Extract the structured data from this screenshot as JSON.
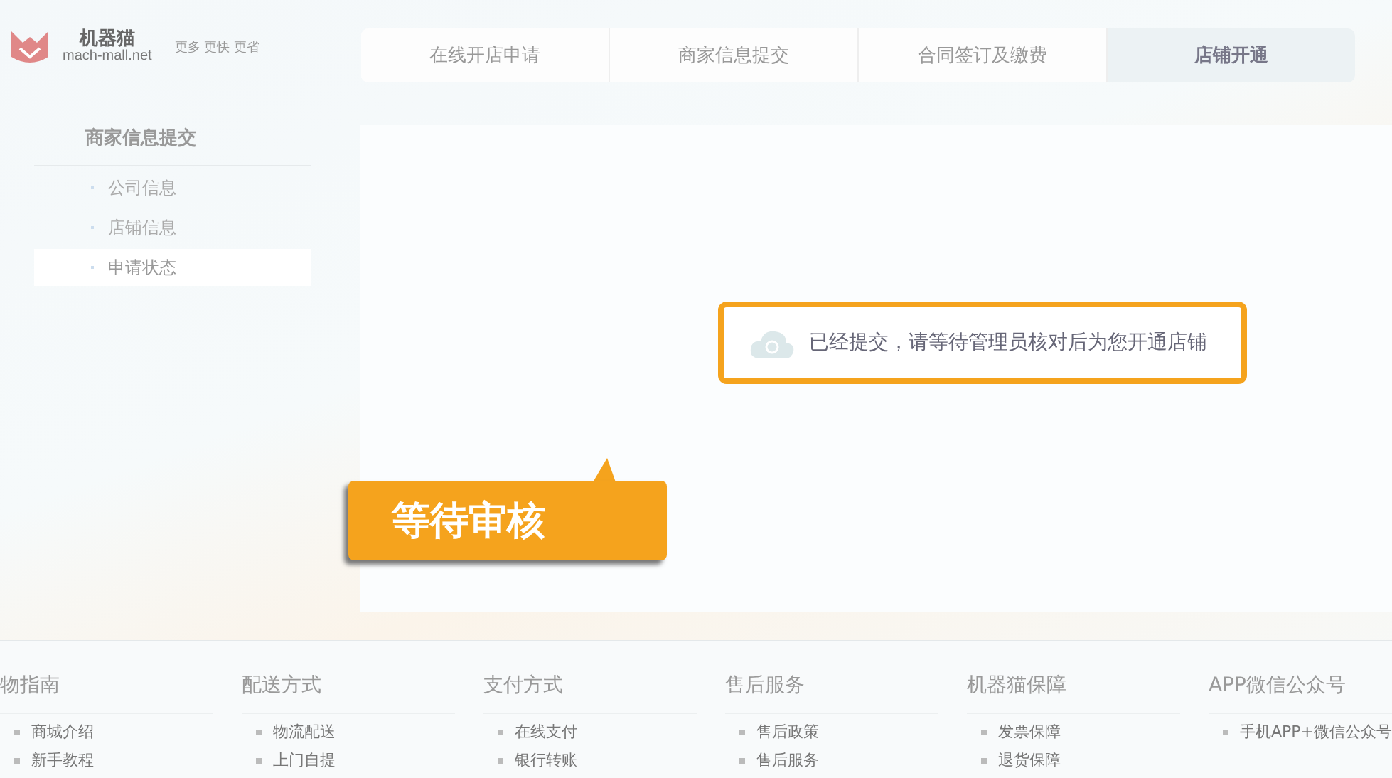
{
  "logo": {
    "name": "机器猫",
    "domain": "mach-mall.net",
    "slogan": "更多 更快 更省"
  },
  "steps": [
    {
      "label": "在线开店申请",
      "selected": false
    },
    {
      "label": "商家信息提交",
      "selected": false
    },
    {
      "label": "合同签订及缴费",
      "selected": false
    },
    {
      "label": "店铺开通",
      "selected": true
    }
  ],
  "sidebar": {
    "title": "商家信息提交",
    "items": [
      {
        "label": "公司信息",
        "selected": false
      },
      {
        "label": "店铺信息",
        "selected": false
      },
      {
        "label": "申请状态",
        "selected": true
      }
    ]
  },
  "notice": "已经提交，请等待管理员核对后为您开通店铺",
  "status_badge": "等待审核",
  "footer": [
    {
      "title": "物指南",
      "links": [
        "商城介绍",
        "新手教程"
      ]
    },
    {
      "title": "配送方式",
      "links": [
        "物流配送",
        "上门自提"
      ]
    },
    {
      "title": "支付方式",
      "links": [
        "在线支付",
        "银行转账"
      ]
    },
    {
      "title": "售后服务",
      "links": [
        "售后政策",
        "售后服务"
      ]
    },
    {
      "title": "机器猫保障",
      "links": [
        "发票保障",
        "退货保障"
      ]
    },
    {
      "title": "APP微信公众号",
      "links": [
        "手机APP+微信公众号"
      ]
    }
  ]
}
